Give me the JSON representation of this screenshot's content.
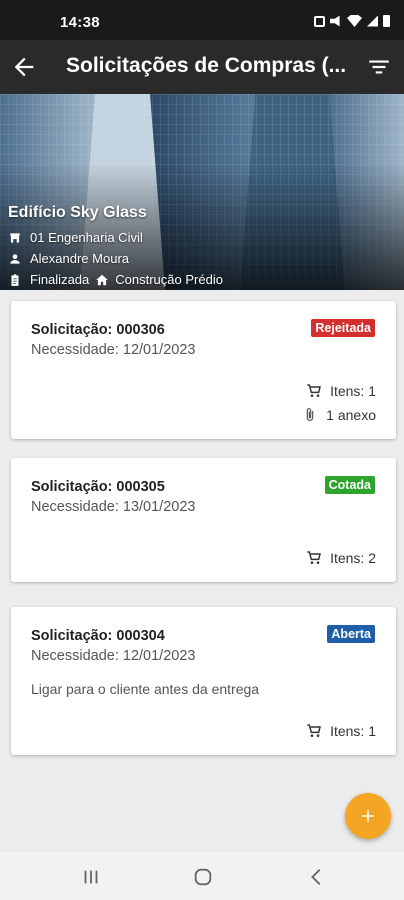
{
  "status_bar": {
    "time": "14:38"
  },
  "app_bar": {
    "title": "Solicitações de Compras (..."
  },
  "project": {
    "name": "Edifício Sky Glass",
    "department": "01 Engenharia Civil",
    "person": "Alexandre Moura",
    "status": "Finalizada",
    "category": "Construção Prédio"
  },
  "requests": [
    {
      "title": "Solicitação: 000306",
      "need_date": "Necessidade: 12/01/2023",
      "note": "",
      "status": "Rejeitada",
      "status_color": "#d32f2f",
      "items": "Itens: 1",
      "attachments": "1 anexo"
    },
    {
      "title": "Solicitação: 000305",
      "need_date": "Necessidade: 13/01/2023",
      "note": "",
      "status": "Cotada",
      "status_color": "#2ea42e",
      "items": "Itens: 2",
      "attachments": ""
    },
    {
      "title": "Solicitação: 000304",
      "need_date": "Necessidade: 12/01/2023",
      "note": "Ligar para o cliente antes da entrega",
      "status": "Aberta",
      "status_color": "#1f5fa8",
      "items": "Itens: 1",
      "attachments": ""
    }
  ],
  "colors": {
    "fab": "#f5a524",
    "app_bar": "#2a2a2a"
  }
}
